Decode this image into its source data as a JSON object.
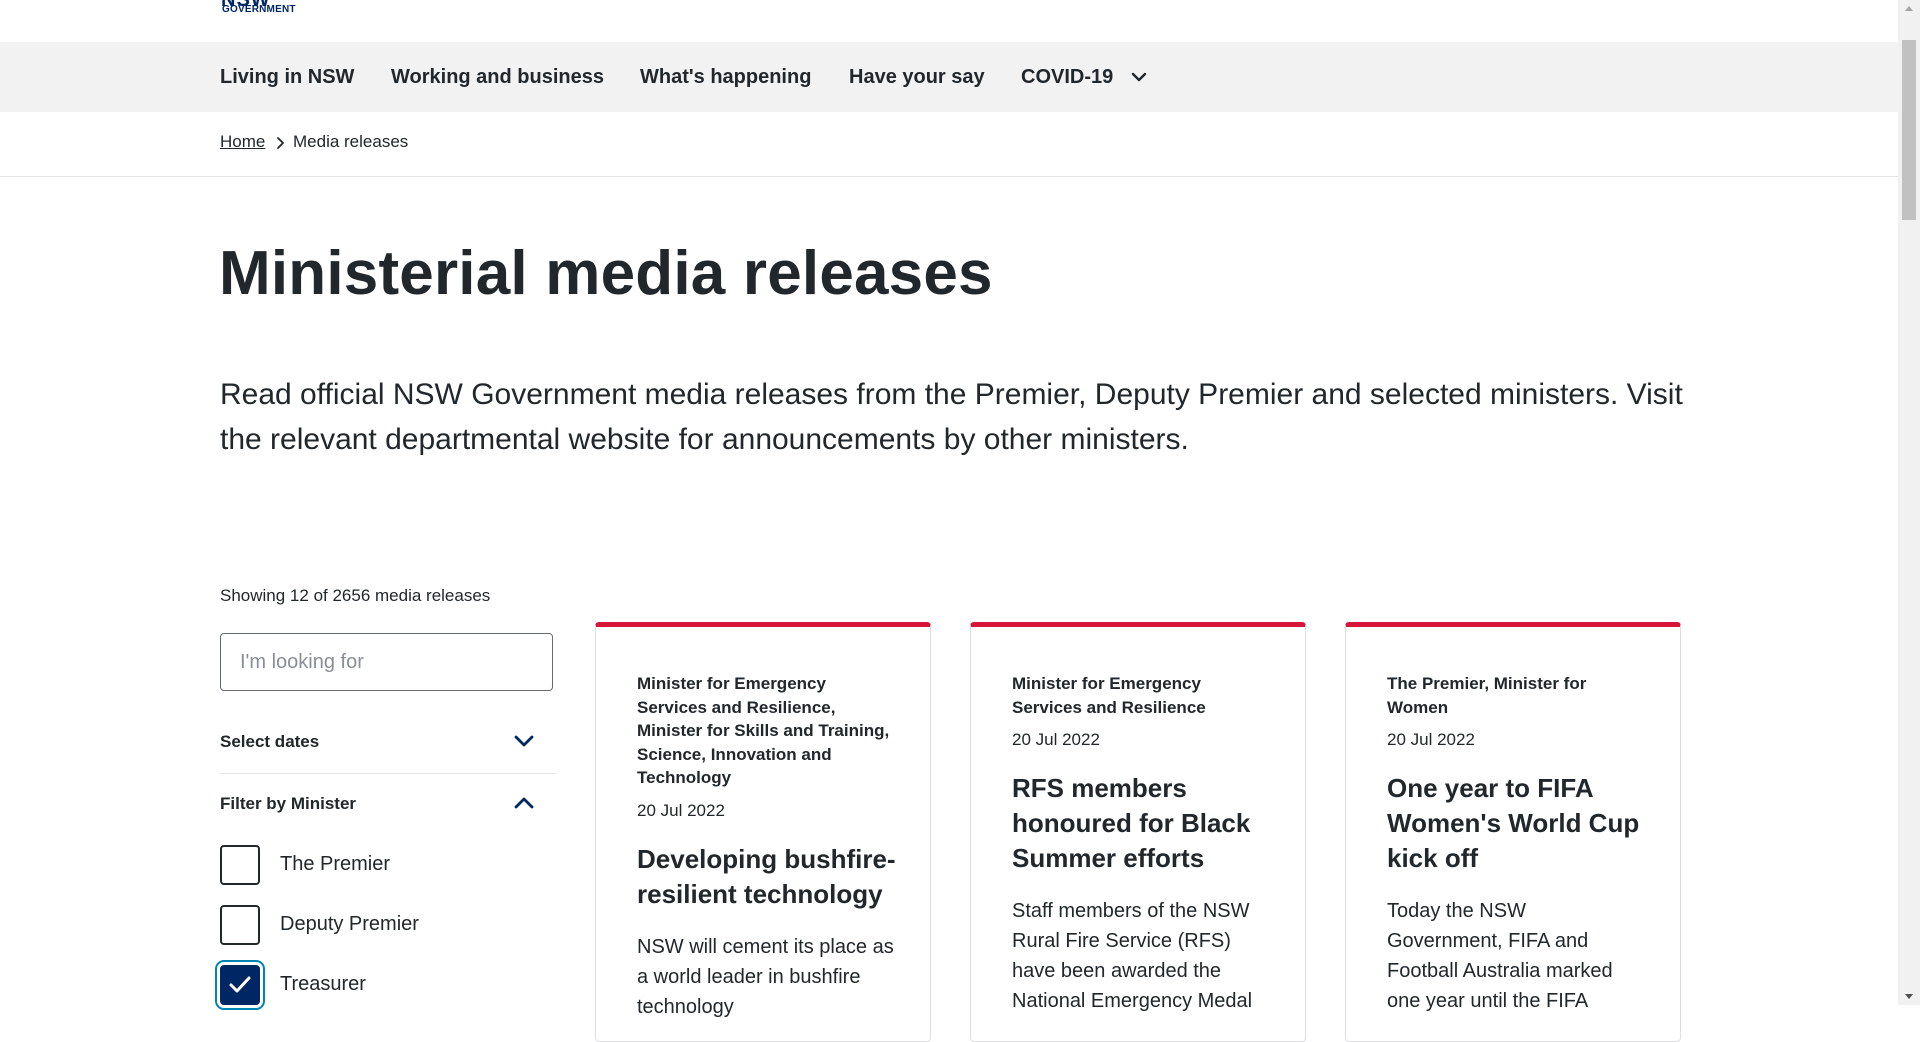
{
  "logo": {
    "top_text": "NSW",
    "sub_text": "GOVERNMENT"
  },
  "nav": {
    "items": [
      {
        "label": "Living in NSW"
      },
      {
        "label": "Working and business"
      },
      {
        "label": "What's happening"
      },
      {
        "label": "Have your say"
      },
      {
        "label": "COVID-19",
        "icon": "chevron-down-icon"
      }
    ]
  },
  "breadcrumb": {
    "home": "Home",
    "current": "Media releases",
    "separator_icon": "chevron-right-icon"
  },
  "page": {
    "title": "Ministerial media releases",
    "intro": "Read official NSW Government media releases from the Premier, Deputy Premier and selected ministers. Visit the relevant departmental website for announcements by other ministers."
  },
  "filters": {
    "showing": "Showing 12 of 2656 media releases",
    "search_placeholder": "I'm looking for",
    "search_value": "",
    "select_dates_label": "Select dates",
    "select_dates_icon": "chevron-down-icon",
    "minister_label": "Filter by Minister",
    "minister_icon": "chevron-up-icon",
    "ministers": [
      {
        "label": "The Premier",
        "checked": false
      },
      {
        "label": "Deputy Premier",
        "checked": false
      },
      {
        "label": "Treasurer",
        "checked": true
      }
    ]
  },
  "cards": [
    {
      "minister": "Minister for Emergency Services and Resilience, Minister for Skills and Training, Science, Innovation and Technology",
      "date": "20 Jul 2022",
      "title": "Developing bushfire-resilient technology",
      "excerpt": "NSW will cement its place as a world leader in bushfire technology"
    },
    {
      "minister": "Minister for Emergency Services and Resilience",
      "date": "20 Jul 2022",
      "title": "RFS members honoured for Black Summer efforts",
      "excerpt": "Staff members of the NSW Rural Fire Service (RFS) have been awarded the National Emergency Medal"
    },
    {
      "minister": "The Premier, Minister for Women",
      "date": "20 Jul 2022",
      "title": "One year to FIFA Women's World Cup kick off",
      "excerpt": "Today the NSW Government, FIFA and Football Australia marked one year until the FIFA"
    }
  ],
  "colors": {
    "accent_red": "#d7153a",
    "brand_navy": "#002664",
    "nav_bg": "#f2f2f2",
    "text": "#22272b"
  }
}
